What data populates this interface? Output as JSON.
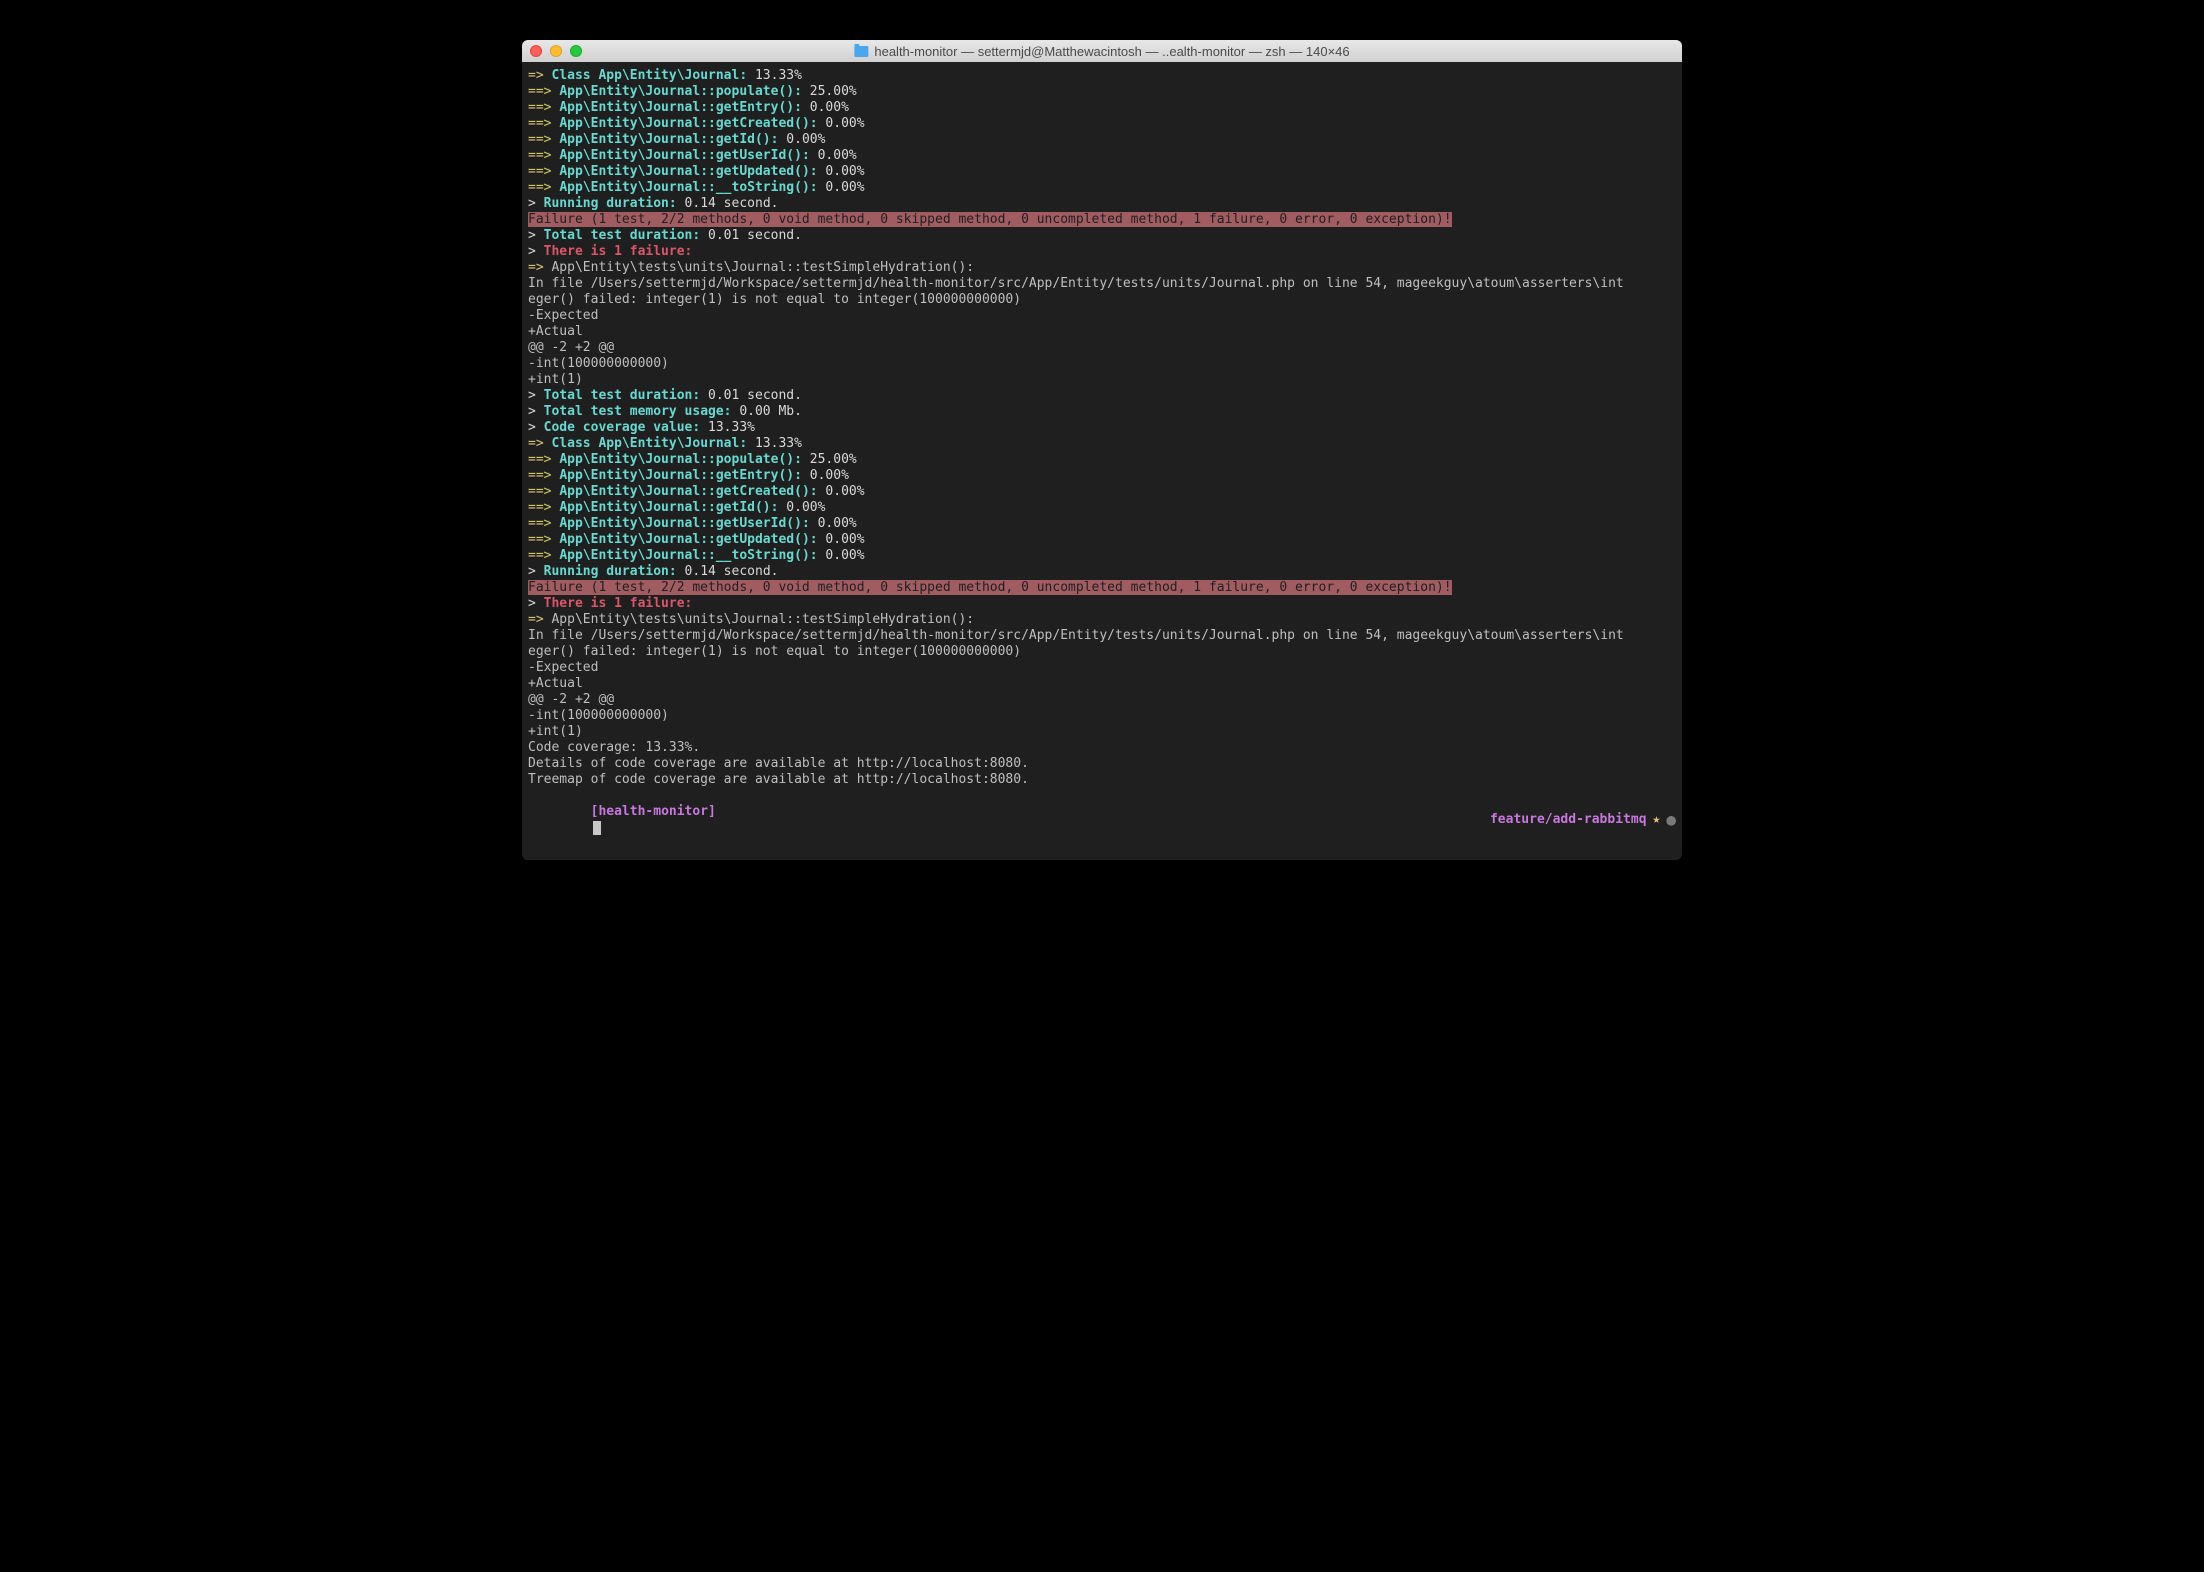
{
  "window": {
    "title": "health-monitor — settermjd@Matthewacintosh — ..ealth-monitor — zsh — 140×46"
  },
  "coverage1": {
    "classLine": {
      "prefix": "=>",
      "label": "Class App\\Entity\\Journal:",
      "pct": "13.33%"
    },
    "methods": [
      {
        "prefix": "==>",
        "label": "App\\Entity\\Journal::populate():",
        "pct": "25.00%"
      },
      {
        "prefix": "==>",
        "label": "App\\Entity\\Journal::getEntry():",
        "pct": "0.00%"
      },
      {
        "prefix": "==>",
        "label": "App\\Entity\\Journal::getCreated():",
        "pct": "0.00%"
      },
      {
        "prefix": "==>",
        "label": "App\\Entity\\Journal::getId():",
        "pct": "0.00%"
      },
      {
        "prefix": "==>",
        "label": "App\\Entity\\Journal::getUserId():",
        "pct": "0.00%"
      },
      {
        "prefix": "==>",
        "label": "App\\Entity\\Journal::getUpdated():",
        "pct": "0.00%"
      },
      {
        "prefix": "==>",
        "label": "App\\Entity\\Journal::__toString():",
        "pct": "0.00%"
      }
    ],
    "runningDuration": {
      "prefix": ">",
      "label": "Running duration:",
      "val": "0.14 second."
    }
  },
  "failureBar1": "Failure (1 test, 2/2 methods, 0 void method, 0 skipped method, 0 uncompleted method, 1 failure, 0 error, 0 exception)!",
  "afterFail1": {
    "totalTestDuration": {
      "prefix": ">",
      "label": "Total test duration:",
      "val": "0.01 second."
    },
    "thereIs": {
      "prefix": ">",
      "text": "There is 1 failure:"
    },
    "testName": {
      "prefix": "=>",
      "text": "App\\Entity\\tests\\units\\Journal::testSimpleHydration():"
    },
    "detail1": "In file /Users/settermjd/Workspace/settermjd/health-monitor/src/App/Entity/tests/units/Journal.php on line 54, mageekguy\\atoum\\asserters\\int",
    "detail2": "eger() failed: integer(1) is not equal to integer(100000000000)",
    "diff": [
      "-Expected",
      "+Actual",
      "@@ -2 +2 @@",
      "-int(100000000000)",
      "+int(1)"
    ]
  },
  "summary": {
    "l1": {
      "prefix": ">",
      "label": "Total test duration:",
      "val": "0.01 second."
    },
    "l2": {
      "prefix": ">",
      "label": "Total test memory usage:",
      "val": "0.00 Mb."
    },
    "l3": {
      "prefix": ">",
      "label": "Code coverage value:",
      "val": "13.33%"
    }
  },
  "coverage2": {
    "classLine": {
      "prefix": "=>",
      "label": "Class App\\Entity\\Journal:",
      "pct": "13.33%"
    },
    "methods": [
      {
        "prefix": "==>",
        "label": "App\\Entity\\Journal::populate():",
        "pct": "25.00%"
      },
      {
        "prefix": "==>",
        "label": "App\\Entity\\Journal::getEntry():",
        "pct": "0.00%"
      },
      {
        "prefix": "==>",
        "label": "App\\Entity\\Journal::getCreated():",
        "pct": "0.00%"
      },
      {
        "prefix": "==>",
        "label": "App\\Entity\\Journal::getId():",
        "pct": "0.00%"
      },
      {
        "prefix": "==>",
        "label": "App\\Entity\\Journal::getUserId():",
        "pct": "0.00%"
      },
      {
        "prefix": "==>",
        "label": "App\\Entity\\Journal::getUpdated():",
        "pct": "0.00%"
      },
      {
        "prefix": "==>",
        "label": "App\\Entity\\Journal::__toString():",
        "pct": "0.00%"
      }
    ],
    "runningDuration": {
      "prefix": ">",
      "label": "Running duration:",
      "val": "0.14 second."
    }
  },
  "failureBar2": "Failure (1 test, 2/2 methods, 0 void method, 0 skipped method, 0 uncompleted method, 1 failure, 0 error, 0 exception)!",
  "afterFail2": {
    "thereIs": {
      "prefix": ">",
      "text": "There is 1 failure:"
    },
    "testName": {
      "prefix": "=>",
      "text": "App\\Entity\\tests\\units\\Journal::testSimpleHydration():"
    },
    "detail1": "In file /Users/settermjd/Workspace/settermjd/health-monitor/src/App/Entity/tests/units/Journal.php on line 54, mageekguy\\atoum\\asserters\\int",
    "detail2": "eger() failed: integer(1) is not equal to integer(100000000000)",
    "diff": [
      "-Expected",
      "+Actual",
      "@@ -2 +2 @@",
      "-int(100000000000)",
      "+int(1)"
    ]
  },
  "trailing": {
    "cov": "Code coverage: 13.33%.",
    "details": "Details of code coverage are available at http://localhost:8080.",
    "treemap": "Treemap of code coverage are available at http://localhost:8080."
  },
  "prompt": {
    "left": "[health-monitor]",
    "branch": "feature/add-rabbitmq"
  }
}
